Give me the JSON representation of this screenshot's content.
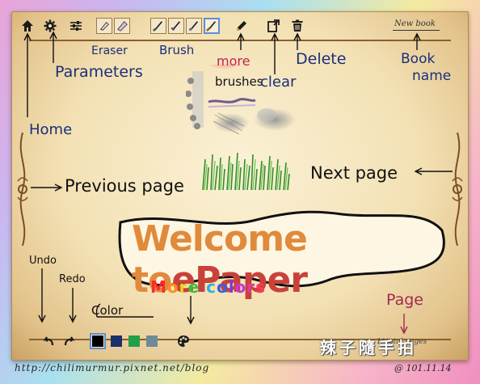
{
  "toolbar": {
    "home_icon": "home-icon",
    "settings_icon": "gear-icon",
    "parameters_icon": "sliders-icon",
    "eraser_icons": [
      "eraser-icon",
      "eraser-icon"
    ],
    "brush_icons": [
      "brush-icon",
      "brush-icon",
      "brush-icon",
      "brush-icon"
    ],
    "pencil_icon": "pencil-icon",
    "clear_icon": "clear-page-icon",
    "delete_icon": "trash-icon"
  },
  "book": {
    "name": "New book"
  },
  "annotations": {
    "eraser": "Eraser",
    "brush": "Brush",
    "parameters": "Parameters",
    "more_brushes_1": "more",
    "more_brushes_2": "brushes",
    "clear": "clear",
    "delete": "Delete",
    "book_name_1": "Book",
    "book_name_2": "name",
    "home": "Home",
    "previous_page": "Previous page",
    "next_page": "Next page",
    "undo": "Undo",
    "redo": "Redo",
    "color": "Color",
    "page": "Page"
  },
  "canvas": {
    "welcome_part1": "Welcome to",
    "welcome_part2": "ePaper",
    "more_colors": [
      "M",
      "o",
      "r",
      "e",
      " ",
      "c",
      "o",
      "l",
      "o",
      "r",
      "s"
    ]
  },
  "colors": {
    "welcome_orange": "#e08a3c",
    "epaper_red": "#c9423a",
    "swatches": [
      "#000000",
      "#1a2f6b",
      "#21a048",
      "#6e8a97"
    ],
    "rainbow": [
      "#ff2a2a",
      "#ff8c1a",
      "#f2d21b",
      "#39c23a",
      "#ffffff",
      "#2bb3d9",
      "#3a5fe0",
      "#7a3ae0",
      "#c13ad9",
      "#e03a9a",
      "#ff3a5a"
    ]
  },
  "footer": {
    "watermark": "http://chilimurmur.pixnet.net/blog",
    "date": "@ 101.11.14",
    "sign": "辣子隨手拍",
    "total_pages": "1/ total pages"
  }
}
